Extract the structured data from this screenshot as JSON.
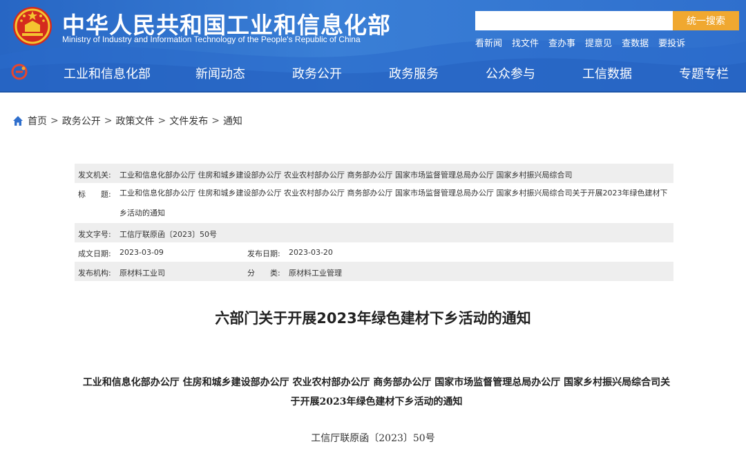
{
  "header": {
    "title_cn": "中华人民共和国工业和信息化部",
    "title_en": "Ministry of Industry and Information Technology of the People's Republic of China",
    "search_placeholder": "",
    "search_button": "统一搜索",
    "quick_links": [
      "看新闻",
      "找文件",
      "查办事",
      "提意见",
      "查数据",
      "要投诉"
    ],
    "nav": [
      "工业和信息化部",
      "新闻动态",
      "政务公开",
      "政务服务",
      "公众参与",
      "工信数据",
      "专题专栏"
    ],
    "colors": {
      "header_blue": "#2f6fcd",
      "search_button": "#f0a830"
    }
  },
  "breadcrumb": {
    "items": [
      "首页",
      "政务公开",
      "政策文件",
      "文件发布",
      "通知"
    ],
    "separator": ">"
  },
  "info": {
    "issuer_label": "发文机关:",
    "issuer_value": "工业和信息化部办公厅 住房和城乡建设部办公厅 农业农村部办公厅 商务部办公厅 国家市场监督管理总局办公厅 国家乡村振兴局综合司",
    "title_label": "标　　题:",
    "title_value": "工业和信息化部办公厅 住房和城乡建设部办公厅 农业农村部办公厅 商务部办公厅 国家市场监督管理总局办公厅 国家乡村振兴局综合司关于开展2023年绿色建材下乡活动的通知",
    "docno_label": "发文字号:",
    "docno_value": "工信厅联原函〔2023〕50号",
    "created_label": "成文日期:",
    "created_value": "2023-03-09",
    "published_label": "发布日期:",
    "published_value": "2023-03-20",
    "org_label": "发布机构:",
    "org_value": "原材料工业司",
    "category_label": "分　　类:",
    "category_value": "原材料工业管理"
  },
  "article": {
    "title": "六部门关于开展2023年绿色建材下乡活动的通知",
    "subtitle": "工业和信息化部办公厅 住房和城乡建设部办公厅 农业农村部办公厅 商务部办公厅 国家市场监督管理总局办公厅 国家乡村振兴局综合司关于开展2023年绿色建材下乡活动的通知",
    "doc_number": "工信厅联原函〔2023〕50号"
  }
}
